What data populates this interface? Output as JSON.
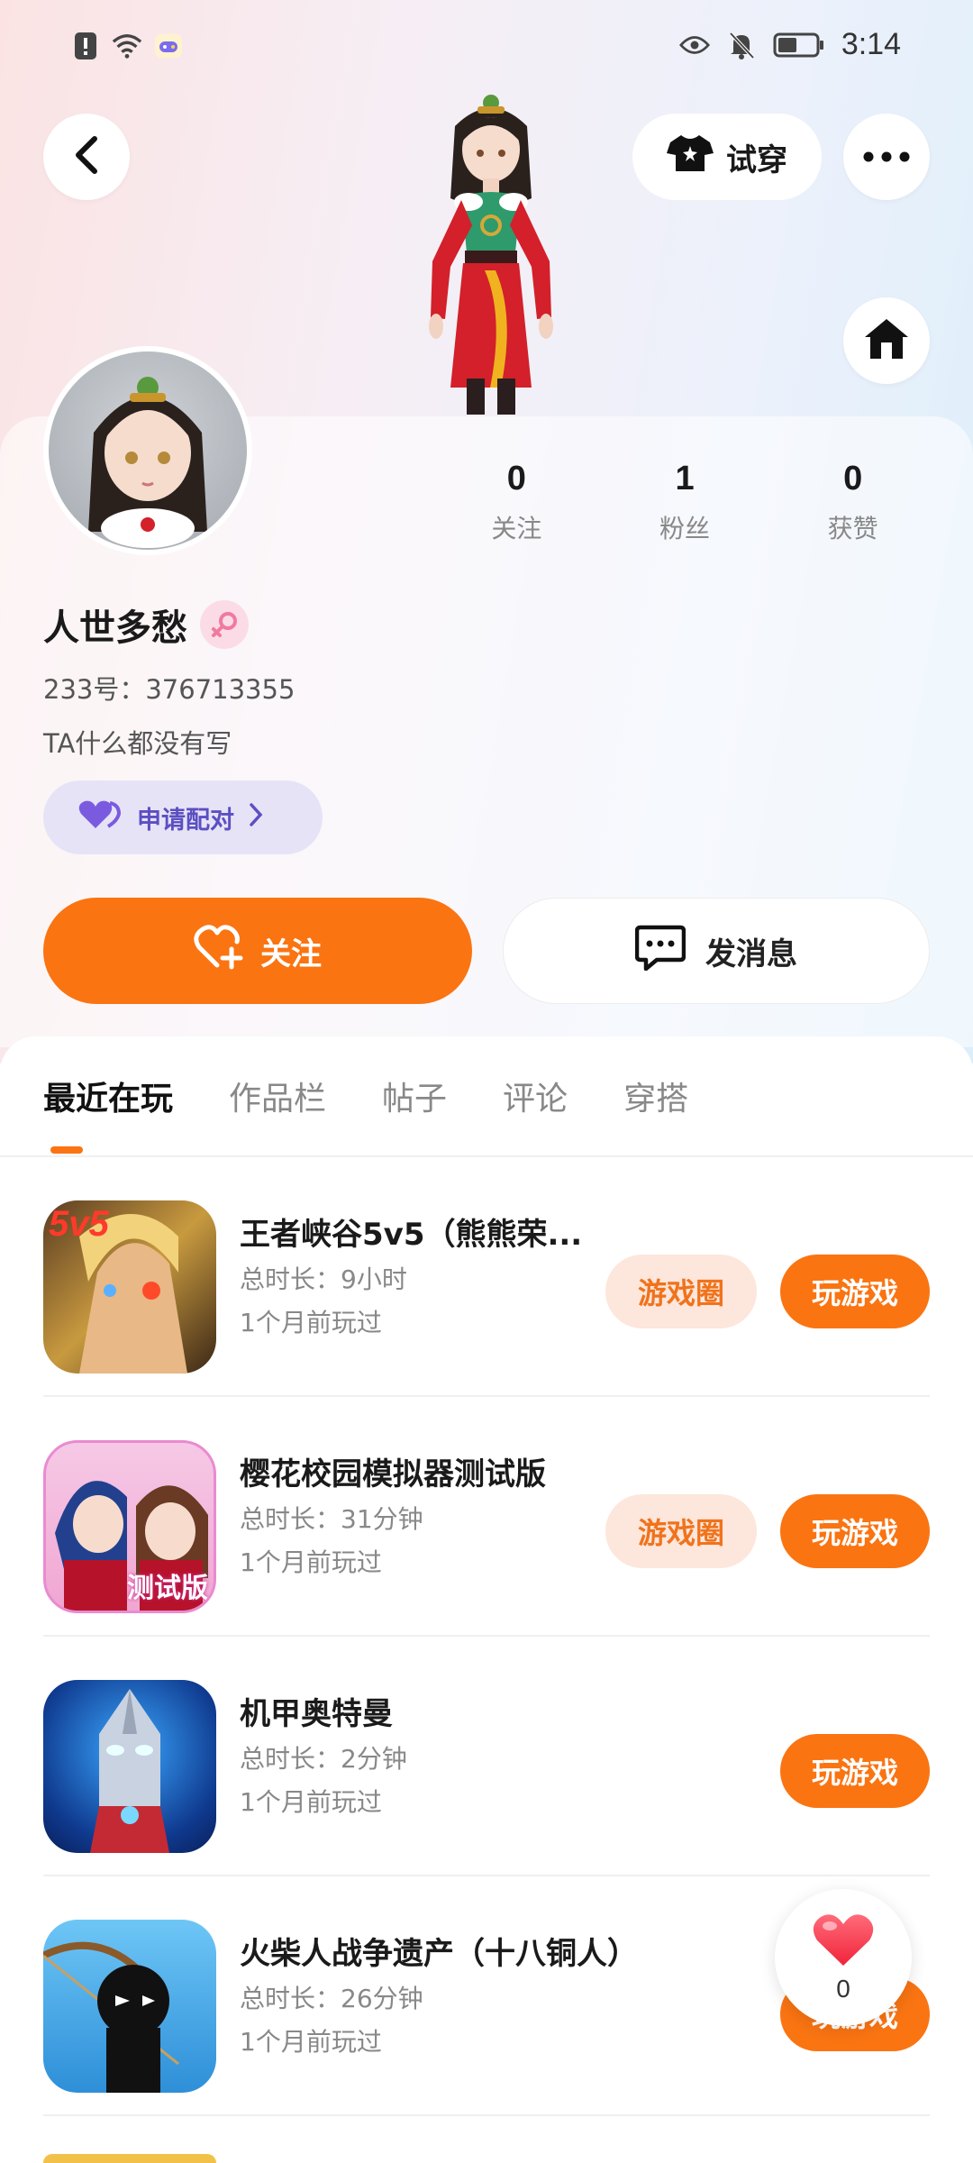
{
  "status_bar": {
    "time": "3:14",
    "left_icons": [
      "alert-icon",
      "wifi-icon",
      "game-mode-icon"
    ],
    "right_icons": [
      "eye-icon",
      "bell-muted-icon",
      "battery-icon"
    ]
  },
  "header": {
    "tryon_label": "试穿",
    "icons": [
      "back-icon",
      "shirt-icon",
      "more-icon",
      "home-icon"
    ]
  },
  "profile": {
    "name": "人世多愁",
    "uid": "233号：376713355",
    "bio": "TA什么都没有写",
    "pair_label": "申请配对",
    "stats": [
      {
        "num": "0",
        "label": "关注"
      },
      {
        "num": "1",
        "label": "粉丝"
      },
      {
        "num": "0",
        "label": "获赞"
      }
    ]
  },
  "actions": {
    "follow_label": "关注",
    "message_label": "发消息"
  },
  "tabs": [
    {
      "label": "最近在玩",
      "active": true
    },
    {
      "label": "作品栏",
      "active": false
    },
    {
      "label": "帖子",
      "active": false
    },
    {
      "label": "评论",
      "active": false
    },
    {
      "label": "穿搭",
      "active": false
    }
  ],
  "games": [
    {
      "title": "王者峡谷5v5（熊熊荣...",
      "duration": "总时长：9小时",
      "last_played": "1个月前玩过",
      "circle_label": "游戏圈",
      "play_label": "玩游戏"
    },
    {
      "title": "樱花校园模拟器测试版",
      "duration": "总时长：31分钟",
      "last_played": "1个月前玩过",
      "circle_label": "游戏圈",
      "play_label": "玩游戏"
    },
    {
      "title": "机甲奥特曼",
      "duration": "总时长：2分钟",
      "last_played": "1个月前玩过",
      "play_label": "玩游戏"
    },
    {
      "title": "火柴人战争遗产（十八铜人）",
      "duration": "总时长：26分钟",
      "last_played": "1个月前玩过",
      "play_label": "玩游戏"
    }
  ],
  "game_icon_texts": {
    "g1_badge": "5v5",
    "g2_badge": "测试版"
  },
  "like_float": {
    "count": "0"
  },
  "colors": {
    "accent": "#fa7412",
    "circle_bg": "#fde6dc",
    "pair_bg": "#e7e3f7"
  }
}
